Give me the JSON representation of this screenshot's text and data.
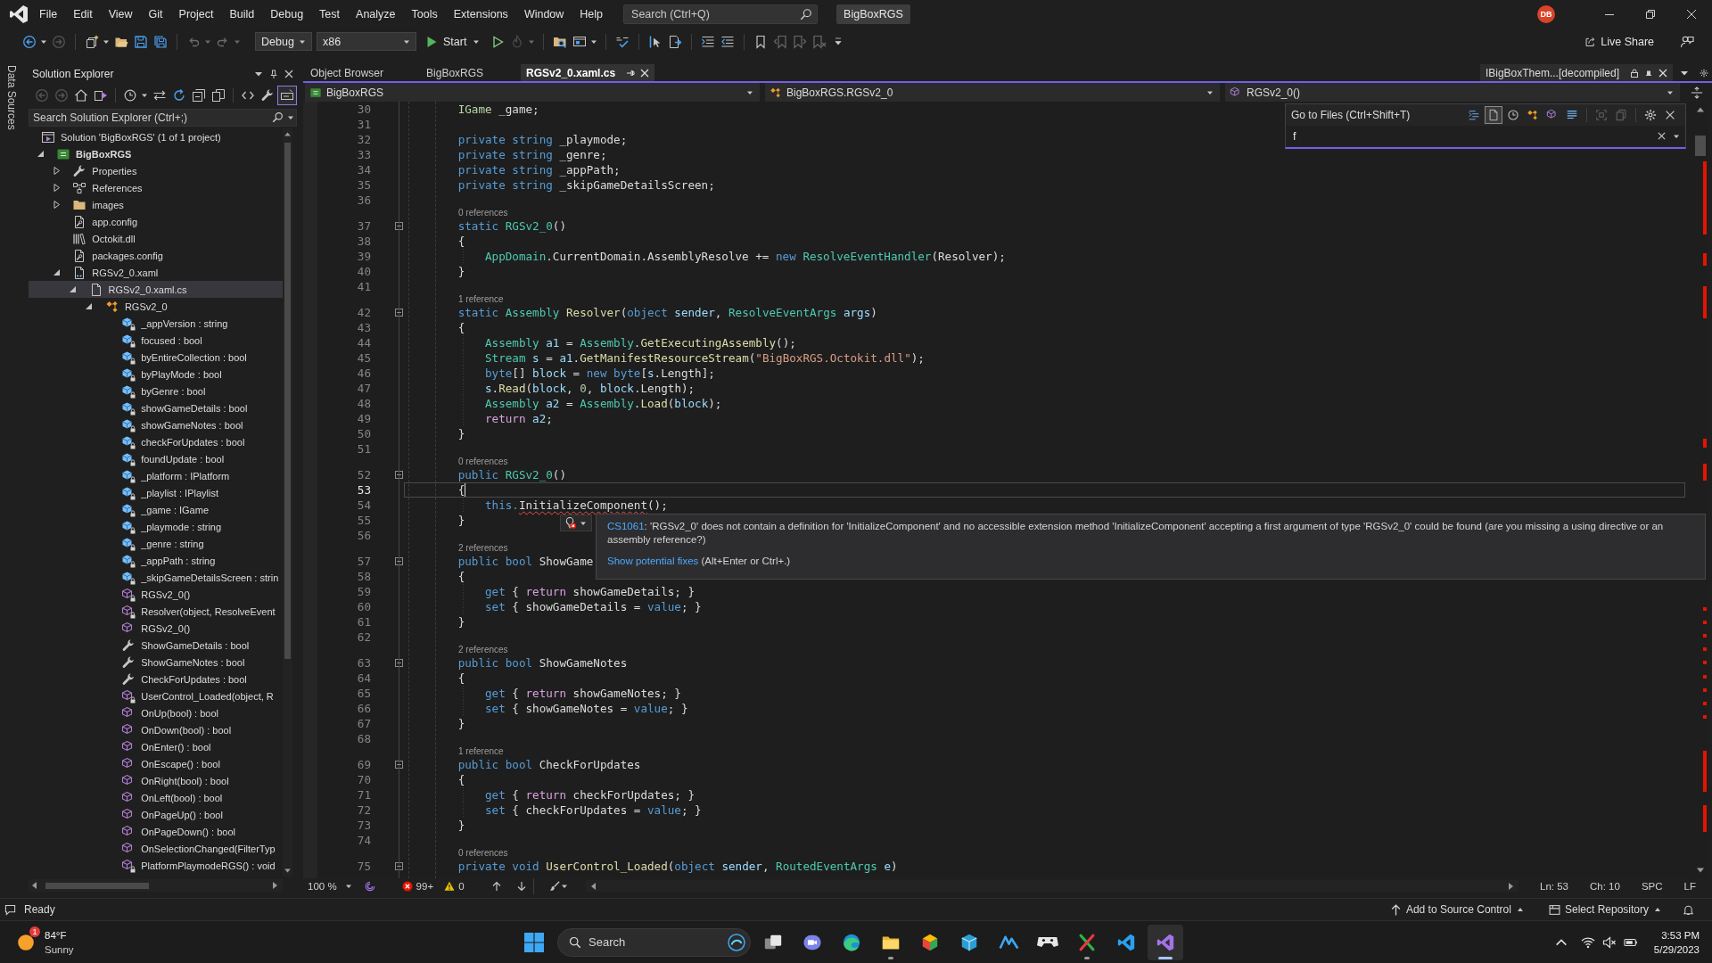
{
  "title_bar": {
    "menus": [
      "File",
      "Edit",
      "View",
      "Git",
      "Project",
      "Build",
      "Debug",
      "Test",
      "Analyze",
      "Tools",
      "Extensions",
      "Window",
      "Help"
    ],
    "search": {
      "placeholder": "Search (Ctrl+Q)"
    },
    "solution_name": "BigBoxRGS",
    "account": {
      "initials": "DB"
    }
  },
  "toolbar": {
    "groups": [
      [
        {
          "kind": "back",
          "disabled": false,
          "menu": true
        },
        {
          "kind": "forward",
          "disabled": true,
          "menu": false
        }
      ],
      [
        {
          "kind": "new-item",
          "disabled": false,
          "menu": true
        },
        {
          "kind": "open",
          "disabled": false,
          "menu": false
        },
        {
          "kind": "save",
          "disabled": false,
          "menu": false
        },
        {
          "kind": "save-all",
          "disabled": false,
          "menu": false
        }
      ],
      [
        {
          "kind": "undo",
          "disabled": true,
          "menu": true
        },
        {
          "kind": "redo",
          "disabled": true,
          "menu": true
        }
      ]
    ],
    "configuration": "Debug",
    "platform": "x86",
    "start": "Start",
    "tools": [
      [
        {
          "kind": "run",
          "disabled": false,
          "menu": false
        },
        {
          "kind": "hot-reload",
          "disabled": true,
          "menu": true
        }
      ],
      [
        {
          "kind": "find-folder",
          "disabled": false,
          "menu": false
        },
        {
          "kind": "window",
          "disabled": false,
          "menu": true
        }
      ],
      [
        {
          "kind": "spell",
          "disabled": false,
          "menu": false
        }
      ],
      [
        {
          "kind": "step",
          "disabled": false,
          "menu": false
        },
        {
          "kind": "browse",
          "disabled": false,
          "menu": false
        }
      ],
      [
        {
          "kind": "comment",
          "disabled": false,
          "menu": false
        },
        {
          "kind": "uncomment",
          "disabled": false,
          "menu": false
        }
      ],
      [
        {
          "kind": "bookmark",
          "disabled": false,
          "menu": false
        },
        {
          "kind": "bookmark-prev",
          "disabled": true,
          "menu": false
        },
        {
          "kind": "bookmark-next",
          "disabled": true,
          "menu": false
        },
        {
          "kind": "bookmark-clear",
          "disabled": true,
          "menu": false
        }
      ]
    ],
    "live_share": "Live Share"
  },
  "side_strip": {
    "label": "Data Sources"
  },
  "solution_explorer": {
    "title": "Solution Explorer",
    "tools": [
      [
        {
          "kind": "back",
          "disabled": true,
          "on": false,
          "menu": false
        },
        {
          "kind": "forward",
          "disabled": true,
          "on": false,
          "menu": false
        },
        {
          "kind": "home",
          "disabled": false,
          "on": false,
          "menu": false
        },
        {
          "kind": "switch-views",
          "disabled": false,
          "on": false,
          "menu": false
        }
      ],
      [
        {
          "kind": "history",
          "disabled": false,
          "on": false,
          "menu": true
        },
        {
          "kind": "sync",
          "disabled": false,
          "on": false,
          "menu": false
        },
        {
          "kind": "refresh",
          "disabled": false,
          "on": false,
          "menu": false
        },
        {
          "kind": "collapse",
          "disabled": false,
          "on": false,
          "menu": false
        },
        {
          "kind": "show-all",
          "disabled": false,
          "on": false,
          "menu": false
        }
      ],
      [
        {
          "kind": "code",
          "disabled": false,
          "on": false,
          "menu": false
        },
        {
          "kind": "properties",
          "disabled": false,
          "on": false,
          "menu": false
        },
        {
          "kind": "preview",
          "disabled": false,
          "on": true,
          "menu": false
        }
      ]
    ],
    "search": {
      "placeholder": "Search Solution Explorer (Ctrl+;)"
    },
    "tree": [
      {
        "label": "Solution 'BigBoxRGS' (1 of 1 project)",
        "kind": "solution",
        "selected": false,
        "children": [
          {
            "label": "BigBoxRGS",
            "kind": "project",
            "selected": false,
            "startup": true,
            "expanded": true,
            "children": [
              {
                "label": "Properties",
                "kind": "properties",
                "selected": false,
                "expanded": false
              },
              {
                "label": "References",
                "kind": "references",
                "selected": false,
                "expanded": false
              },
              {
                "label": "images",
                "kind": "folder",
                "selected": false,
                "expanded": false
              },
              {
                "label": "app.config",
                "kind": "config",
                "selected": false
              },
              {
                "label": "Octokit.dll",
                "kind": "library",
                "selected": false
              },
              {
                "label": "packages.config",
                "kind": "config",
                "selected": false
              },
              {
                "label": "RGSv2_0.xaml",
                "kind": "xaml",
                "selected": false,
                "expanded": true,
                "children": [
                  {
                    "label": "RGSv2_0.xaml.cs",
                    "kind": "code-file",
                    "selected": true,
                    "expanded": true,
                    "children": [
                      {
                        "label": "RGSv2_0",
                        "kind": "class",
                        "selected": false,
                        "expanded": true,
                        "children": [
                          {
                            "label": "_appVersion : string",
                            "kind": "field",
                            "private": true,
                            "selected": false
                          },
                          {
                            "label": "focused : bool",
                            "kind": "field",
                            "private": true,
                            "selected": false
                          },
                          {
                            "label": "byEntireCollection : bool",
                            "kind": "field",
                            "private": true,
                            "selected": false
                          },
                          {
                            "label": "byPlayMode : bool",
                            "kind": "field",
                            "private": true,
                            "selected": false
                          },
                          {
                            "label": "byGenre : bool",
                            "kind": "field",
                            "private": true,
                            "selected": false
                          },
                          {
                            "label": "showGameDetails : bool",
                            "kind": "field",
                            "private": true,
                            "selected": false
                          },
                          {
                            "label": "showGameNotes : bool",
                            "kind": "field",
                            "private": true,
                            "selected": false
                          },
                          {
                            "label": "checkForUpdates : bool",
                            "kind": "field",
                            "private": true,
                            "selected": false
                          },
                          {
                            "label": "foundUpdate : bool",
                            "kind": "field",
                            "private": true,
                            "selected": false
                          },
                          {
                            "label": "_platform : IPlatform",
                            "kind": "field",
                            "private": true,
                            "selected": false
                          },
                          {
                            "label": "_playlist : IPlaylist",
                            "kind": "field",
                            "private": true,
                            "selected": false
                          },
                          {
                            "label": "_game : IGame",
                            "kind": "field",
                            "private": true,
                            "selected": false
                          },
                          {
                            "label": "_playmode : string",
                            "kind": "field",
                            "private": true,
                            "selected": false
                          },
                          {
                            "label": "_genre : string",
                            "kind": "field",
                            "private": true,
                            "selected": false
                          },
                          {
                            "label": "_appPath : string",
                            "kind": "field",
                            "private": true,
                            "selected": false
                          },
                          {
                            "label": "_skipGameDetailsScreen : strin",
                            "kind": "field",
                            "private": true,
                            "selected": false
                          },
                          {
                            "label": "RGSv2_0()",
                            "kind": "method",
                            "private": true,
                            "selected": false
                          },
                          {
                            "label": "Resolver(object, ResolveEvent",
                            "kind": "method",
                            "private": true,
                            "selected": false
                          },
                          {
                            "label": "RGSv2_0()",
                            "kind": "method",
                            "private": false,
                            "selected": false
                          },
                          {
                            "label": "ShowGameDetails : bool",
                            "kind": "property",
                            "private": false,
                            "selected": false
                          },
                          {
                            "label": "ShowGameNotes : bool",
                            "kind": "property",
                            "private": false,
                            "selected": false
                          },
                          {
                            "label": "CheckForUpdates : bool",
                            "kind": "property",
                            "private": false,
                            "selected": false
                          },
                          {
                            "label": "UserControl_Loaded(object, R",
                            "kind": "method",
                            "private": true,
                            "selected": false
                          },
                          {
                            "label": "OnUp(bool) : bool",
                            "kind": "method",
                            "private": false,
                            "selected": false
                          },
                          {
                            "label": "OnDown(bool) : bool",
                            "kind": "method",
                            "private": false,
                            "selected": false
                          },
                          {
                            "label": "OnEnter() : bool",
                            "kind": "method",
                            "private": false,
                            "selected": false
                          },
                          {
                            "label": "OnEscape() : bool",
                            "kind": "method",
                            "private": false,
                            "selected": false
                          },
                          {
                            "label": "OnRight(bool) : bool",
                            "kind": "method",
                            "private": false,
                            "selected": false
                          },
                          {
                            "label": "OnLeft(bool) : bool",
                            "kind": "method",
                            "private": false,
                            "selected": false
                          },
                          {
                            "label": "OnPageUp() : bool",
                            "kind": "method",
                            "private": false,
                            "selected": false
                          },
                          {
                            "label": "OnPageDown() : bool",
                            "kind": "method",
                            "private": false,
                            "selected": false
                          },
                          {
                            "label": "OnSelectionChanged(FilterTyp",
                            "kind": "method",
                            "private": false,
                            "selected": false
                          },
                          {
                            "label": "PlatformPlaymodeRGS() : void",
                            "kind": "method",
                            "private": true,
                            "selected": false
                          }
                        ]
                      }
                    ]
                  }
                ]
              }
            ]
          }
        ]
      }
    ]
  },
  "editor": {
    "tabs": [
      {
        "label": "Object Browser",
        "selected": false
      },
      {
        "label": "BigBoxRGS",
        "selected": false
      },
      {
        "label": "RGSv2_0.xaml.cs",
        "selected": true
      }
    ],
    "preview_tab": {
      "label": "IBigBoxThem...[decompiled]",
      "read_only": true
    },
    "nav": [
      {
        "kind": "project",
        "label": "BigBoxRGS"
      },
      {
        "kind": "class",
        "label": "BigBoxRGS.RGSv2_0"
      },
      {
        "kind": "method",
        "label": "RGSv2_0()"
      }
    ],
    "go_to": {
      "title": "Go to Files (Ctrl+Shift+T)",
      "filters": [
        {
          "kind": "lines",
          "selected": false
        },
        {
          "kind": "files",
          "selected": true
        },
        {
          "kind": "recent",
          "selected": false
        },
        {
          "kind": "types",
          "selected": false
        },
        {
          "kind": "members",
          "selected": false
        },
        {
          "kind": "text",
          "selected": false
        }
      ],
      "scopes": [
        {
          "kind": "document",
          "disabled": true
        },
        {
          "kind": "project",
          "disabled": true
        }
      ],
      "value": "f"
    },
    "lines": [
      {
        "number": "30",
        "current": false,
        "tokens": [
          {
            "kind": "interface",
            "text": "        IGame"
          },
          {
            "kind": "plain",
            "text": " _game;"
          }
        ]
      },
      {
        "number": "31",
        "current": false
      },
      {
        "number": "32",
        "current": false,
        "tokens": [
          {
            "kind": "keyword",
            "text": "        private string"
          },
          {
            "kind": "plain",
            "text": " _playmode;"
          }
        ]
      },
      {
        "number": "33",
        "current": false,
        "tokens": [
          {
            "kind": "keyword",
            "text": "        private string"
          },
          {
            "kind": "plain",
            "text": " _genre;"
          }
        ]
      },
      {
        "number": "34",
        "current": false,
        "tokens": [
          {
            "kind": "keyword",
            "text": "        private string"
          },
          {
            "kind": "plain",
            "text": " _appPath;"
          }
        ]
      },
      {
        "number": "35",
        "current": false,
        "tokens": [
          {
            "kind": "keyword",
            "text": "        private string"
          },
          {
            "kind": "plain",
            "text": " _skipGameDetailsScreen;"
          }
        ]
      },
      {
        "number": "36",
        "current": false
      },
      {
        "number": "37",
        "current": false,
        "references": "0 references",
        "expanded": true,
        "tokens": [
          {
            "kind": "keyword",
            "text": "        static "
          },
          {
            "kind": "type",
            "text": "RGSv2_0"
          },
          {
            "kind": "plain",
            "text": "()"
          }
        ]
      },
      {
        "number": "38",
        "current": false,
        "tokens": [
          {
            "kind": "plain",
            "text": "        {"
          }
        ]
      },
      {
        "number": "39",
        "current": false,
        "tokens": [
          {
            "kind": "type",
            "text": "            AppDomain"
          },
          {
            "kind": "plain",
            "text": ".CurrentDomain.AssemblyResolve += "
          },
          {
            "kind": "keyword",
            "text": "new "
          },
          {
            "kind": "type",
            "text": "ResolveEventHandler"
          },
          {
            "kind": "plain",
            "text": "(Resolver);"
          }
        ]
      },
      {
        "number": "40",
        "current": false,
        "tokens": [
          {
            "kind": "plain",
            "text": "        }"
          }
        ]
      },
      {
        "number": "41",
        "current": false
      },
      {
        "number": "42",
        "current": false,
        "references": "1 reference",
        "expanded": true,
        "tokens": [
          {
            "kind": "keyword",
            "text": "        static "
          },
          {
            "kind": "type",
            "text": "Assembly "
          },
          {
            "kind": "method",
            "text": "Resolver"
          },
          {
            "kind": "plain",
            "text": "("
          },
          {
            "kind": "keyword",
            "text": "object "
          },
          {
            "kind": "local",
            "text": "sender"
          },
          {
            "kind": "plain",
            "text": ", "
          },
          {
            "kind": "type",
            "text": "ResolveEventArgs "
          },
          {
            "kind": "local",
            "text": "args"
          },
          {
            "kind": "plain",
            "text": ")"
          }
        ]
      },
      {
        "number": "43",
        "current": false,
        "tokens": [
          {
            "kind": "plain",
            "text": "        {"
          }
        ]
      },
      {
        "number": "44",
        "current": false,
        "tokens": [
          {
            "kind": "type",
            "text": "            Assembly "
          },
          {
            "kind": "local",
            "text": "a1"
          },
          {
            "kind": "plain",
            "text": " = "
          },
          {
            "kind": "type",
            "text": "Assembly"
          },
          {
            "kind": "plain",
            "text": "."
          },
          {
            "kind": "method",
            "text": "GetExecutingAssembly"
          },
          {
            "kind": "plain",
            "text": "();"
          }
        ]
      },
      {
        "number": "45",
        "current": false,
        "tokens": [
          {
            "kind": "type",
            "text": "            Stream "
          },
          {
            "kind": "local",
            "text": "s"
          },
          {
            "kind": "plain",
            "text": " = "
          },
          {
            "kind": "local",
            "text": "a1"
          },
          {
            "kind": "plain",
            "text": "."
          },
          {
            "kind": "method",
            "text": "GetManifestResourceStream"
          },
          {
            "kind": "plain",
            "text": "("
          },
          {
            "kind": "string",
            "text": "\"BigBoxRGS.Octokit.dll\""
          },
          {
            "kind": "plain",
            "text": ");"
          }
        ]
      },
      {
        "number": "46",
        "current": false,
        "tokens": [
          {
            "kind": "keyword",
            "text": "            byte"
          },
          {
            "kind": "plain",
            "text": "[] "
          },
          {
            "kind": "local",
            "text": "block"
          },
          {
            "kind": "plain",
            "text": " = "
          },
          {
            "kind": "keyword",
            "text": "new byte"
          },
          {
            "kind": "plain",
            "text": "["
          },
          {
            "kind": "local",
            "text": "s"
          },
          {
            "kind": "plain",
            "text": ".Length];"
          }
        ]
      },
      {
        "number": "47",
        "current": false,
        "tokens": [
          {
            "kind": "local",
            "text": "            s"
          },
          {
            "kind": "plain",
            "text": "."
          },
          {
            "kind": "method",
            "text": "Read"
          },
          {
            "kind": "plain",
            "text": "("
          },
          {
            "kind": "local",
            "text": "block"
          },
          {
            "kind": "plain",
            "text": ", "
          },
          {
            "kind": "number",
            "text": "0"
          },
          {
            "kind": "plain",
            "text": ", "
          },
          {
            "kind": "local",
            "text": "block"
          },
          {
            "kind": "plain",
            "text": ".Length);"
          }
        ]
      },
      {
        "number": "48",
        "current": false,
        "tokens": [
          {
            "kind": "type",
            "text": "            Assembly "
          },
          {
            "kind": "local",
            "text": "a2"
          },
          {
            "kind": "plain",
            "text": " = "
          },
          {
            "kind": "type",
            "text": "Assembly"
          },
          {
            "kind": "plain",
            "text": "."
          },
          {
            "kind": "method",
            "text": "Load"
          },
          {
            "kind": "plain",
            "text": "("
          },
          {
            "kind": "local",
            "text": "block"
          },
          {
            "kind": "plain",
            "text": ");"
          }
        ]
      },
      {
        "number": "49",
        "current": false,
        "tokens": [
          {
            "kind": "control",
            "text": "            return "
          },
          {
            "kind": "local",
            "text": "a2"
          },
          {
            "kind": "plain",
            "text": ";"
          }
        ]
      },
      {
        "number": "50",
        "current": false,
        "tokens": [
          {
            "kind": "plain",
            "text": "        }"
          }
        ]
      },
      {
        "number": "51",
        "current": false
      },
      {
        "number": "52",
        "current": false,
        "references": "0 references",
        "expanded": true,
        "tokens": [
          {
            "kind": "keyword",
            "text": "        public "
          },
          {
            "kind": "type",
            "text": "RGSv2_0"
          },
          {
            "kind": "plain",
            "text": "()"
          }
        ]
      },
      {
        "number": "53",
        "current": true,
        "tokens": [
          {
            "kind": "plain",
            "text": "        {"
          }
        ]
      },
      {
        "number": "54",
        "current": false,
        "tokens": [
          {
            "kind": "keyword",
            "text": "            this."
          },
          {
            "kind": "error",
            "text": "InitializeComponent"
          },
          {
            "kind": "plain",
            "text": "();"
          }
        ]
      },
      {
        "number": "55",
        "current": false,
        "tokens": [
          {
            "kind": "plain",
            "text": "        }"
          }
        ]
      },
      {
        "number": "56",
        "current": false
      },
      {
        "number": "57",
        "current": false,
        "references": "2 references",
        "expanded": true,
        "tokens": [
          {
            "kind": "keyword",
            "text": "        public bool"
          },
          {
            "kind": "plain",
            "text": " ShowGame"
          }
        ]
      },
      {
        "number": "58",
        "current": false,
        "tokens": [
          {
            "kind": "plain",
            "text": "        {"
          }
        ]
      },
      {
        "number": "59",
        "current": false,
        "tokens": [
          {
            "kind": "keyword",
            "text": "            get"
          },
          {
            "kind": "plain",
            "text": " { "
          },
          {
            "kind": "control",
            "text": "return"
          },
          {
            "kind": "plain",
            "text": " showGameDetails; }"
          }
        ]
      },
      {
        "number": "60",
        "current": false,
        "tokens": [
          {
            "kind": "keyword",
            "text": "            set"
          },
          {
            "kind": "plain",
            "text": " { showGameDetails = "
          },
          {
            "kind": "keyword",
            "text": "value"
          },
          {
            "kind": "plain",
            "text": "; }"
          }
        ]
      },
      {
        "number": "61",
        "current": false,
        "tokens": [
          {
            "kind": "plain",
            "text": "        }"
          }
        ]
      },
      {
        "number": "62",
        "current": false
      },
      {
        "number": "63",
        "current": false,
        "references": "2 references",
        "expanded": true,
        "tokens": [
          {
            "kind": "keyword",
            "text": "        public bool"
          },
          {
            "kind": "plain",
            "text": " ShowGameNotes"
          }
        ]
      },
      {
        "number": "64",
        "current": false,
        "tokens": [
          {
            "kind": "plain",
            "text": "        {"
          }
        ]
      },
      {
        "number": "65",
        "current": false,
        "tokens": [
          {
            "kind": "keyword",
            "text": "            get"
          },
          {
            "kind": "plain",
            "text": " { "
          },
          {
            "kind": "control",
            "text": "return"
          },
          {
            "kind": "plain",
            "text": " showGameNotes; }"
          }
        ]
      },
      {
        "number": "66",
        "current": false,
        "tokens": [
          {
            "kind": "keyword",
            "text": "            set"
          },
          {
            "kind": "plain",
            "text": " { showGameNotes = "
          },
          {
            "kind": "keyword",
            "text": "value"
          },
          {
            "kind": "plain",
            "text": "; }"
          }
        ]
      },
      {
        "number": "67",
        "current": false,
        "tokens": [
          {
            "kind": "plain",
            "text": "        }"
          }
        ]
      },
      {
        "number": "68",
        "current": false
      },
      {
        "number": "69",
        "current": false,
        "references": "1 reference",
        "expanded": true,
        "tokens": [
          {
            "kind": "keyword",
            "text": "        public bool"
          },
          {
            "kind": "plain",
            "text": " CheckForUpdates"
          }
        ]
      },
      {
        "number": "70",
        "current": false,
        "tokens": [
          {
            "kind": "plain",
            "text": "        {"
          }
        ]
      },
      {
        "number": "71",
        "current": false,
        "tokens": [
          {
            "kind": "keyword",
            "text": "            get"
          },
          {
            "kind": "plain",
            "text": " { "
          },
          {
            "kind": "control",
            "text": "return"
          },
          {
            "kind": "plain",
            "text": " checkForUpdates; }"
          }
        ]
      },
      {
        "number": "72",
        "current": false,
        "tokens": [
          {
            "kind": "keyword",
            "text": "            set"
          },
          {
            "kind": "plain",
            "text": " { checkForUpdates = "
          },
          {
            "kind": "keyword",
            "text": "value"
          },
          {
            "kind": "plain",
            "text": "; }"
          }
        ]
      },
      {
        "number": "73",
        "current": false,
        "tokens": [
          {
            "kind": "plain",
            "text": "        }"
          }
        ]
      },
      {
        "number": "74",
        "current": false
      },
      {
        "number": "75",
        "current": false,
        "references": "0 references",
        "expanded": true,
        "tokens": [
          {
            "kind": "keyword",
            "text": "        private void "
          },
          {
            "kind": "method",
            "text": "UserControl_Loaded"
          },
          {
            "kind": "plain",
            "text": "("
          },
          {
            "kind": "keyword",
            "text": "object "
          },
          {
            "kind": "local",
            "text": "sender"
          },
          {
            "kind": "plain",
            "text": ", "
          },
          {
            "kind": "type",
            "text": "RoutedEventArgs "
          },
          {
            "kind": "local",
            "text": "e"
          },
          {
            "kind": "plain",
            "text": ")"
          }
        ]
      }
    ],
    "tooltip": {
      "code": "CS1061",
      "message": ": 'RGSv2_0' does not contain a definition for 'InitializeComponent' and no accessible extension method 'InitializeComponent' accepting a first argument of type 'RGSv2_0' could be found (are you missing a using directive or an assembly reference?)",
      "fix": "Show potential fixes",
      "shortcut": "(Alt+Enter or Ctrl+.)"
    },
    "status": {
      "zoom": "100 %",
      "errors": "99+",
      "warnings": "0",
      "line": "Ln: 53",
      "column": "Ch: 10",
      "indent": "SPC",
      "line_ending": "LF"
    }
  },
  "status_bar": {
    "message": "Ready",
    "source_control": "Add to Source Control",
    "repository": "Select Repository"
  },
  "taskbar": {
    "weather": {
      "badge": "1",
      "temperature": "84°F",
      "condition": "Sunny"
    },
    "search": {
      "placeholder": "Search"
    },
    "apps": [
      {
        "kind": "task-view",
        "running": false,
        "selected": false
      },
      {
        "kind": "chat",
        "running": false,
        "selected": false
      },
      {
        "kind": "browser",
        "running": false,
        "selected": false
      },
      {
        "kind": "files",
        "running": true,
        "selected": false
      },
      {
        "kind": "color-cube",
        "running": false,
        "selected": false
      },
      {
        "kind": "box",
        "running": false,
        "selected": false
      },
      {
        "kind": "zigzag",
        "running": false,
        "selected": false
      },
      {
        "kind": "gamepad",
        "running": false,
        "selected": false
      },
      {
        "kind": "cross",
        "running": true,
        "selected": false
      },
      {
        "kind": "ribbon",
        "running": false,
        "selected": false
      },
      {
        "kind": "infinity",
        "running": true,
        "selected": true
      }
    ],
    "clock": {
      "time": "3:53 PM",
      "date": "5/29/2023"
    }
  }
}
